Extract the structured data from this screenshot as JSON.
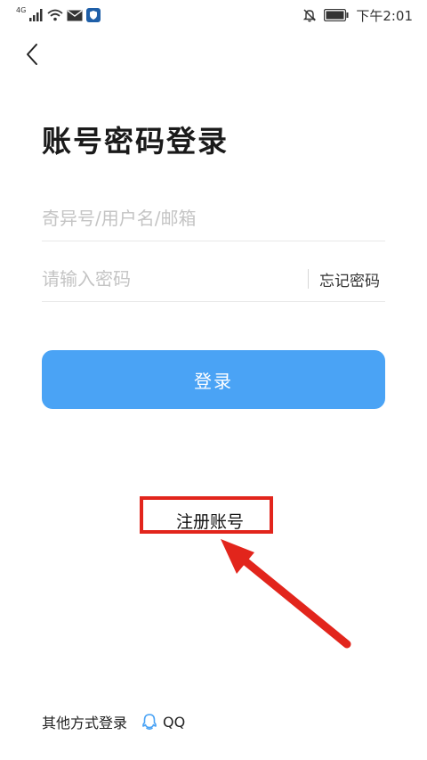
{
  "status_bar": {
    "network_type": "4G",
    "time": "下午2:01"
  },
  "page": {
    "title": "账号密码登录"
  },
  "form": {
    "username_placeholder": "奇异号/用户名/邮箱",
    "password_placeholder": "请输入密码",
    "forgot_label": "忘记密码",
    "login_label": "登录"
  },
  "register": {
    "label": "注册账号"
  },
  "other_login": {
    "label": "其他方式登录",
    "qq_label": "QQ"
  },
  "colors": {
    "accent": "#4aa3f5",
    "annotation": "#e2251c"
  }
}
